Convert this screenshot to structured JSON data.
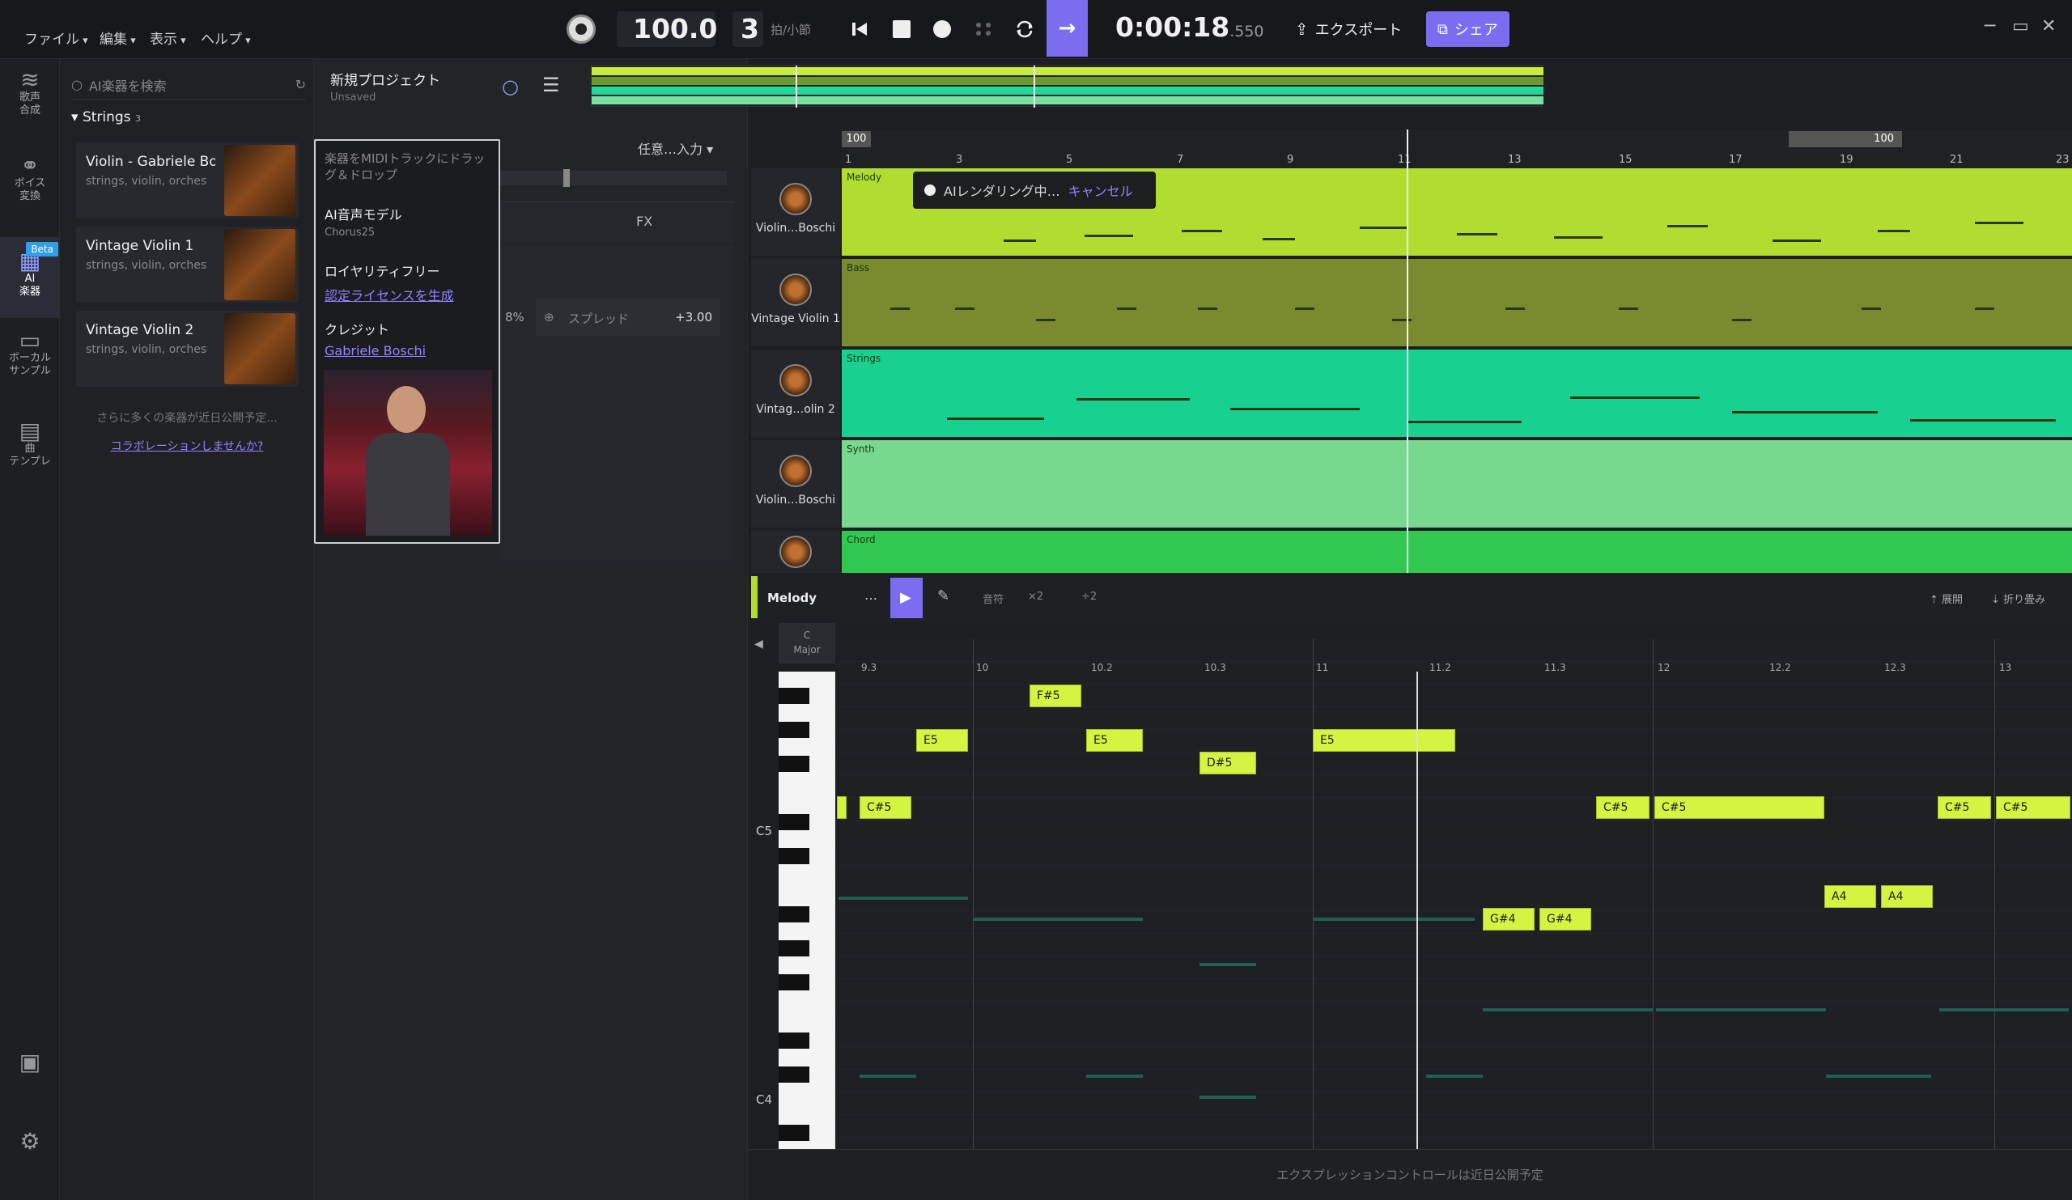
{
  "menu": [
    "ファイル",
    "編集",
    "表示",
    "ヘルプ"
  ],
  "transport": {
    "tempo": "100.0",
    "beats": "3",
    "beats_unit": "拍/小節",
    "time_main": "0:00:18",
    "time_ms": ".550"
  },
  "toolbar": {
    "export": "エクスポート",
    "share": "シェア"
  },
  "rail": [
    {
      "label1": "歌声",
      "label2": "合成",
      "icon": "voice-synth-icon"
    },
    {
      "label1": "ボイス",
      "label2": "変換",
      "icon": "voice-convert-icon"
    },
    {
      "label1": "AI",
      "label2": "楽器",
      "icon": "ai-instrument-icon",
      "badge": "Beta"
    },
    {
      "label1": "ボーカル",
      "label2": "サンプル",
      "icon": "vocal-sample-icon"
    },
    {
      "label1": "曲",
      "label2": "テンプレ",
      "icon": "template-icon"
    }
  ],
  "instruments": {
    "search_placeholder": "AI楽器を検索",
    "group": "Strings",
    "group_count": "3",
    "cards": [
      {
        "title": "Violin - Gabriele Bos",
        "sub": "strings, violin, orchestra"
      },
      {
        "title": "Vintage Violin 1",
        "sub": "strings, violin, orchestra"
      },
      {
        "title": "Vintage Violin 2",
        "sub": "strings, violin, orchestra"
      }
    ],
    "more": "さらに多くの楽器が近日公開予定...",
    "collab": "コラボレーションしませんか?"
  },
  "popup": {
    "drag_hint": "楽器をMIDIトラックにドラッグ＆ドロップ",
    "model_h": "AI音声モデル",
    "model_v": "Chorus25",
    "royalty_h": "ロイヤリティフリー",
    "royalty_link": "認定ライセンスを生成",
    "credit_h": "クレジット",
    "credit_link": "Gabriele Boschi"
  },
  "project": {
    "name": "新規プロジェクト",
    "status": "Unsaved",
    "input": "任意…入力",
    "fx": "FX",
    "pct": "8%",
    "spread": "スプレッド",
    "spread_val": "+3.00"
  },
  "ruler_ticks": [
    "1",
    "3",
    "5",
    "7",
    "9",
    "11",
    "13",
    "15",
    "17",
    "19",
    "21",
    "23"
  ],
  "ruler_tempo": "100",
  "tracks": [
    {
      "name": "Violin…Boschi",
      "lane": "Melody",
      "color": "#a8d830"
    },
    {
      "name": "Vintage Violin 1",
      "lane": "Bass",
      "color": "#7a8a30"
    },
    {
      "name": "Vintag…olin 2",
      "lane": "Strings",
      "color": "#18d090"
    },
    {
      "name": "Violin…Boschi",
      "lane": "Synth",
      "color": "#78d890"
    },
    {
      "name": "",
      "lane": "Chord",
      "color": "#30c850"
    }
  ],
  "render_toast": {
    "text": "AIレンダリング中…",
    "cancel": "キャンセル"
  },
  "piano_roll": {
    "track": "Melody",
    "more": "…",
    "note_tool": "音符",
    "x2": "×2",
    "plus2": "÷2",
    "expand": "展開",
    "fold": "折り畳み",
    "key": "C",
    "scale": "Major",
    "c5": "C5",
    "c4": "C4",
    "beats": [
      "9.3",
      "10",
      "10.2",
      "10.3",
      "11",
      "11.2",
      "11.3",
      "12",
      "12.2",
      "12.3",
      "13"
    ],
    "notes": [
      "F#5",
      "E5",
      "E5",
      "D#5",
      "E5",
      "C#5",
      "C#5",
      "C#5",
      "C#5",
      "C#5",
      "G#4",
      "G#4",
      "A4",
      "A4"
    ],
    "footer": "エクスプレッションコントロールは近日公開予定"
  }
}
